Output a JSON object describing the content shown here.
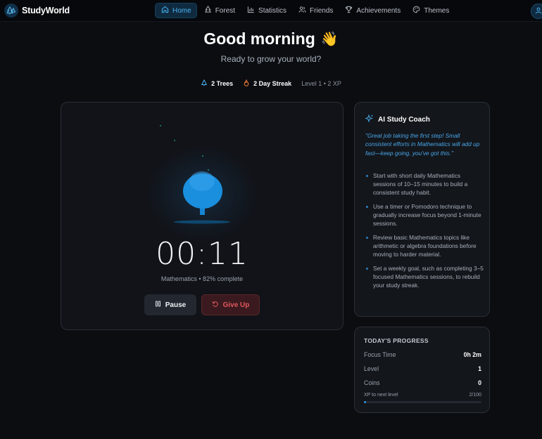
{
  "brand": {
    "name": "StudyWorld"
  },
  "nav": {
    "items": [
      {
        "label": "Home",
        "icon": "home-icon",
        "active": true
      },
      {
        "label": "Forest",
        "icon": "tree-icon",
        "active": false
      },
      {
        "label": "Statistics",
        "icon": "bar-chart-icon",
        "active": false
      },
      {
        "label": "Friends",
        "icon": "users-icon",
        "active": false
      },
      {
        "label": "Achievements",
        "icon": "trophy-icon",
        "active": false
      },
      {
        "label": "Themes",
        "icon": "palette-icon",
        "active": false
      }
    ]
  },
  "greeting": {
    "title": "Good morning",
    "emoji": "👋",
    "subtitle": "Ready to grow your world?"
  },
  "stats": {
    "trees": "2 Trees",
    "streak": "2 Day Streak",
    "level_xp": "Level 1 • 2 XP"
  },
  "timer": {
    "time": "00:11",
    "subject_line": "Mathematics • 82% complete",
    "progress_fraction": 0.82,
    "pause_label": "Pause",
    "giveup_label": "Give Up"
  },
  "coach": {
    "title": "AI Study Coach",
    "quote": "\"Great job taking the first step! Small consistent efforts in Mathematics will add up fast—keep going, you've got this.\"",
    "tips": [
      "Start with short daily Mathematics sessions of 10–15 minutes to build a consistent study habit.",
      "Use a timer or Pomodoro technique to gradually increase focus beyond 1-minute sessions.",
      "Review basic Mathematics topics like arithmetic or algebra foundations before moving to harder material.",
      "Set a weekly goal, such as completing 3–5 focused Mathematics sessions, to rebuild your study streak."
    ]
  },
  "progress": {
    "title": "TODAY'S PROGRESS",
    "rows": [
      {
        "label": "Focus Time",
        "value": "0h 2m"
      },
      {
        "label": "Level",
        "value": "1"
      },
      {
        "label": "Coins",
        "value": "0"
      }
    ],
    "xp_label": "XP to next level",
    "xp_text": "2/100",
    "xp_fraction": 0.02
  },
  "colors": {
    "accent": "#2e9be8",
    "danger": "#e0575c",
    "background": "#0b0d11",
    "card": "#111318"
  }
}
